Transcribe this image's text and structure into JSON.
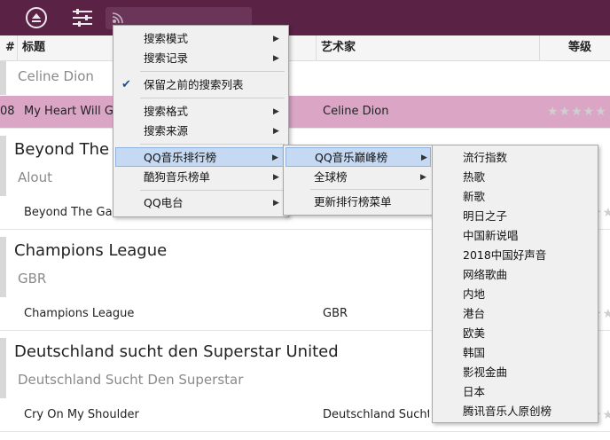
{
  "colors": {
    "toolbar": "#5a2346",
    "selected_row": "#dba6c6",
    "menu_highlight": "#c5d9f2"
  },
  "toolbar": {
    "icons": [
      "playlist-eject-icon",
      "equalizer-settings-icon",
      "rss-icon"
    ]
  },
  "columns": {
    "num": "#",
    "title": "标题",
    "artist": "艺术家",
    "rating": "等级"
  },
  "groups": [
    {
      "title": "",
      "subtitle": "Celine Dion"
    },
    {
      "title": "Beyond The Game",
      "subtitle": "Alout"
    },
    {
      "title": "Champions League",
      "subtitle": "GBR"
    },
    {
      "title": "Deutschland sucht den Superstar United",
      "subtitle": "Deutschland Sucht Den Superstar"
    }
  ],
  "rows": [
    {
      "num": "08",
      "title": "My Heart Will Go On",
      "artist": "Celine Dion",
      "stars": "★★★★★"
    },
    {
      "num": "",
      "title": "Beyond The Game",
      "artist": "Alout",
      "stars": "★★"
    },
    {
      "num": "",
      "title": "Champions League",
      "artist": "GBR",
      "stars": "★★"
    },
    {
      "num": "",
      "title": "Cry On My Shoulder",
      "artist": "Deutschland Sucht Den Superstar",
      "stars": "★★"
    }
  ],
  "menu_main": {
    "items": [
      "搜索模式",
      "搜索记录",
      "保留之前的搜索列表",
      "搜索格式",
      "搜索来源",
      "QQ音乐排行榜",
      "酷狗音乐榜单",
      "QQ电台"
    ],
    "checked_index": 2
  },
  "menu_qq": {
    "items": [
      "QQ音乐巅峰榜",
      "全球榜",
      "更新排行榜菜单"
    ]
  },
  "menu_peak": {
    "items": [
      "流行指数",
      "热歌",
      "新歌",
      "明日之子",
      "中国新说唱",
      "2018中国好声音",
      "网络歌曲",
      "内地",
      "港台",
      "欧美",
      "韩国",
      "影视金曲",
      "日本",
      "腾讯音乐人原创榜"
    ]
  }
}
